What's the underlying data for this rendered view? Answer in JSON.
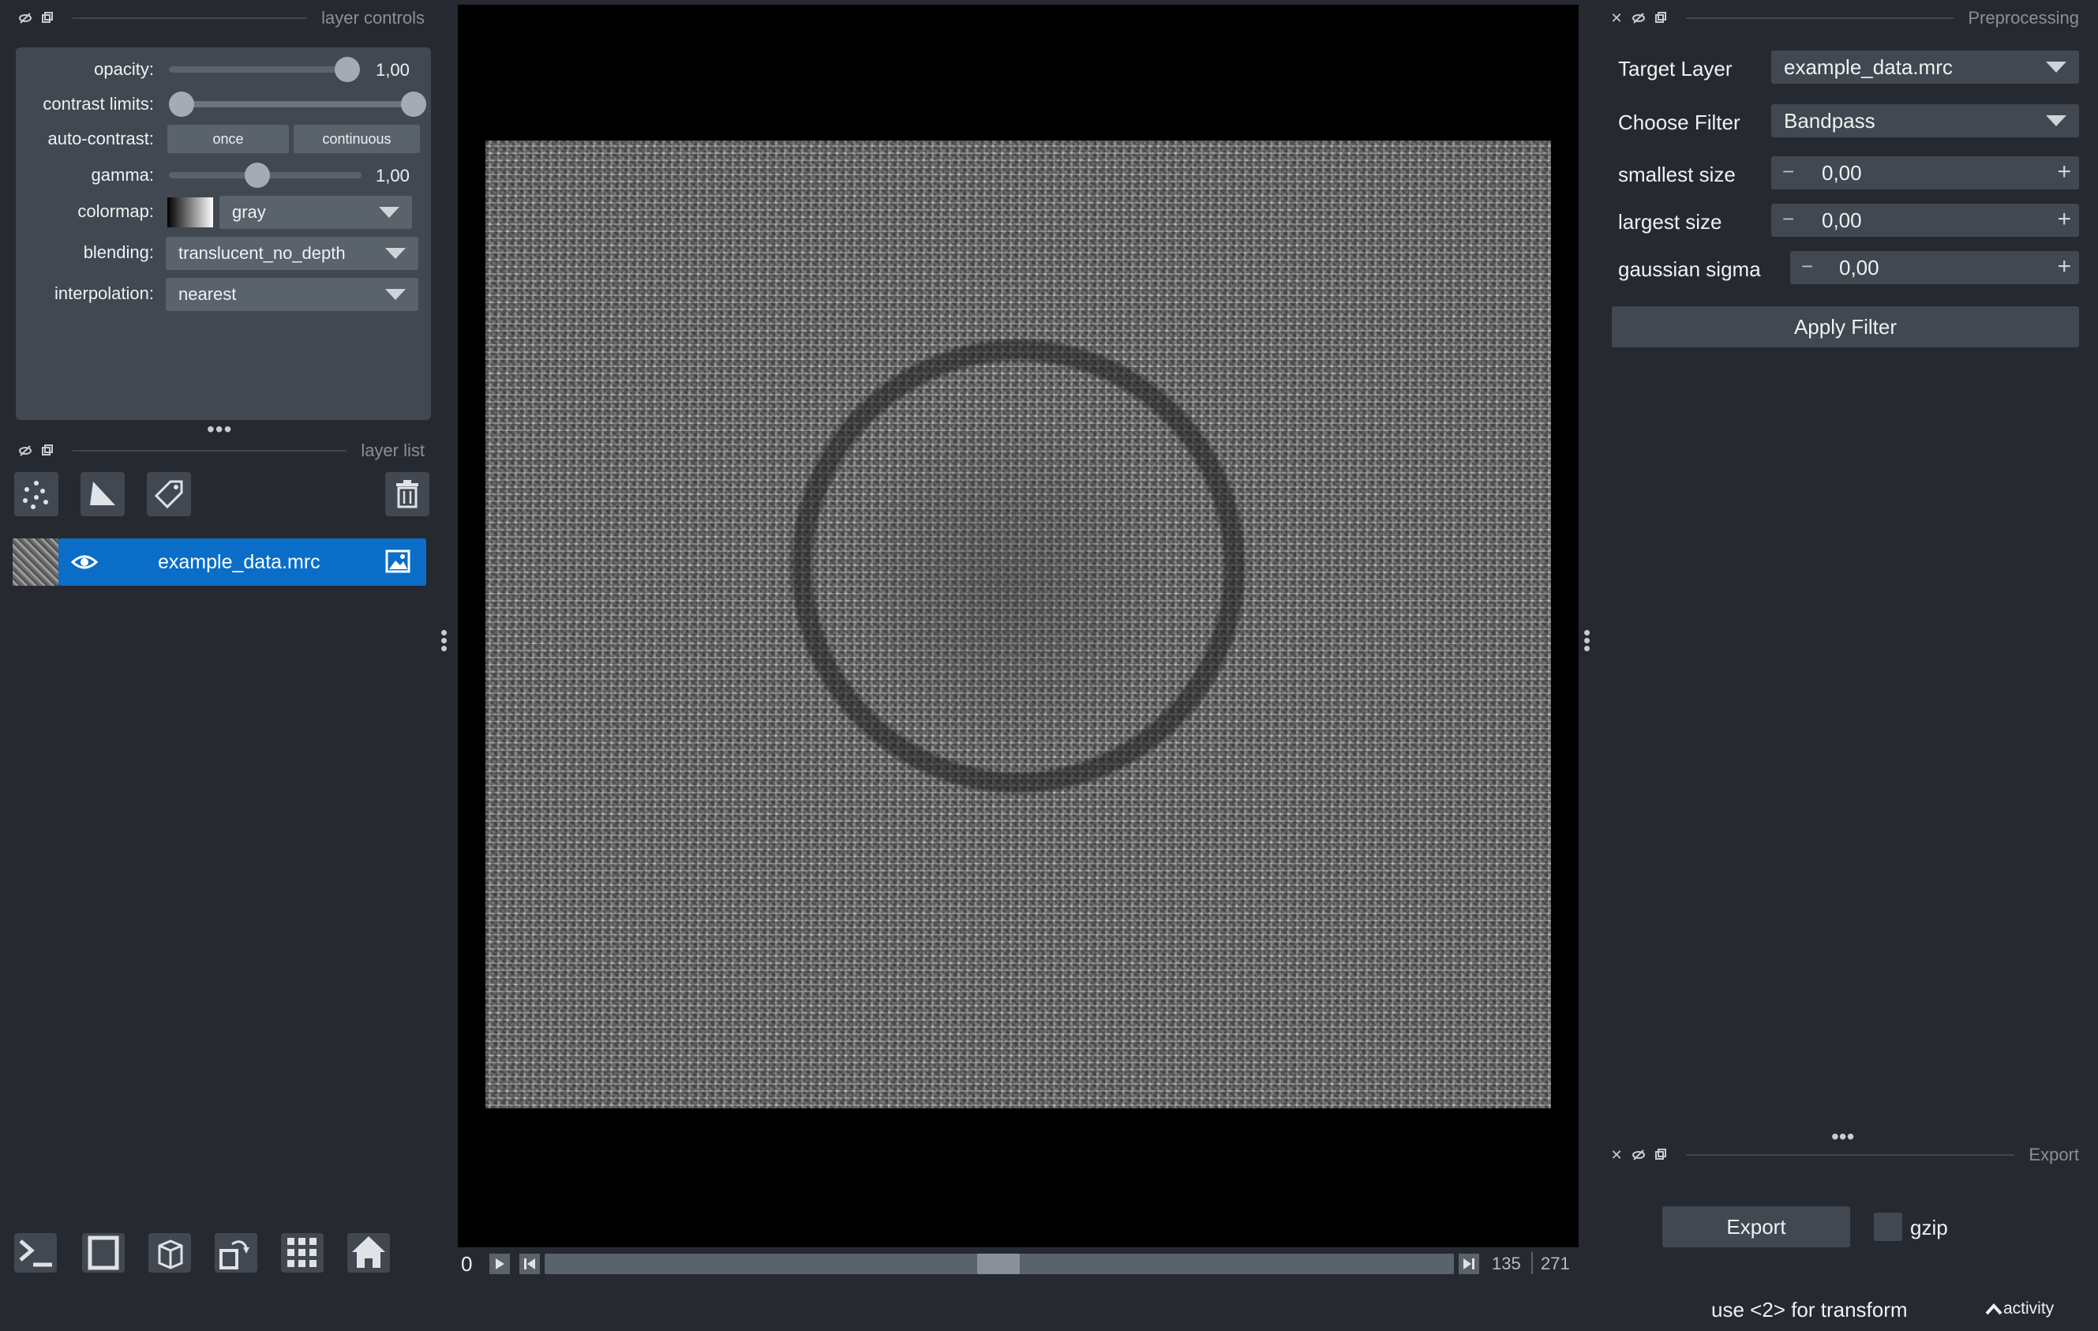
{
  "layer_controls": {
    "title": "layer controls",
    "opacity": {
      "label": "opacity:",
      "value": "1,00",
      "level": 1.0
    },
    "contrast_limits": {
      "label": "contrast limits:",
      "low": 0.0,
      "high": 1.0
    },
    "auto_contrast": {
      "label": "auto-contrast:",
      "once": "once",
      "continuous": "continuous"
    },
    "gamma": {
      "label": "gamma:",
      "value": "1,00",
      "level": 0.45
    },
    "colormap": {
      "label": "colormap:",
      "value": "gray"
    },
    "blending": {
      "label": "blending:",
      "value": "translucent_no_depth"
    },
    "interpolation": {
      "label": "interpolation:",
      "value": "nearest"
    }
  },
  "layer_list": {
    "title": "layer list",
    "layers": [
      {
        "name": "example_data.mrc"
      }
    ]
  },
  "viewer": {
    "frame_start": "0",
    "current": "135",
    "total": "271",
    "position": 0.5
  },
  "preprocessing": {
    "title": "Preprocessing",
    "target_layer": {
      "label": "Target Layer",
      "value": "example_data.mrc"
    },
    "choose_filter": {
      "label": "Choose Filter",
      "value": "Bandpass"
    },
    "smallest_size": {
      "label": "smallest size",
      "value": "0,00"
    },
    "largest_size": {
      "label": "largest size",
      "value": "0,00"
    },
    "gaussian_sigma": {
      "label": "gaussian sigma",
      "value": "0,00"
    },
    "apply": "Apply Filter"
  },
  "export": {
    "title": "Export",
    "button": "Export",
    "gzip_label": "gzip",
    "gzip_checked": false
  },
  "status": {
    "message": "use <2> for transform",
    "activity": "activity"
  }
}
